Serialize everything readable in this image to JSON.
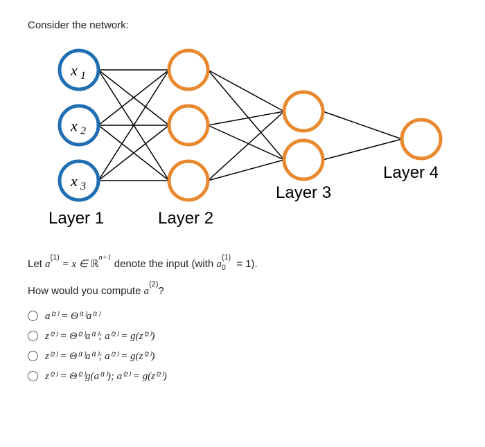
{
  "prompt": "Consider the network:",
  "diagram": {
    "input_labels": [
      "x",
      "x",
      "x"
    ],
    "input_subs": [
      "1",
      "2",
      "3"
    ],
    "layer_labels": [
      "Layer 1",
      "Layer 2",
      "Layer 3",
      "Layer 4"
    ]
  },
  "question": {
    "line1_pre": "Let ",
    "line1_a": "a",
    "line1_sup1": "(1)",
    "line1_eq": " = x ∈ ",
    "line1_R": "ℝ",
    "line1_exp": "n+1",
    "line1_mid": " denote the input (with ",
    "line1_a2": "a",
    "line1_supsub_sup": "(1)",
    "line1_supsub_sub": "0",
    "line1_end": " = 1).",
    "line2_pre": "How would you compute ",
    "line2_a": "a",
    "line2_sup": "(2)",
    "line2_end": "?"
  },
  "options": {
    "a": "a⁽²⁾ = Θ⁽¹⁾a⁽¹⁾",
    "b": "z⁽²⁾ = Θ⁽²⁾a⁽¹⁾;  a⁽²⁾ = g(z⁽²⁾)",
    "c": "z⁽²⁾ = Θ⁽¹⁾a⁽¹⁾;  a⁽²⁾ = g(z⁽²⁾)",
    "d": "z⁽²⁾ = Θ⁽²⁾g(a⁽¹⁾);  a⁽²⁾ = g(z⁽²⁾)"
  }
}
